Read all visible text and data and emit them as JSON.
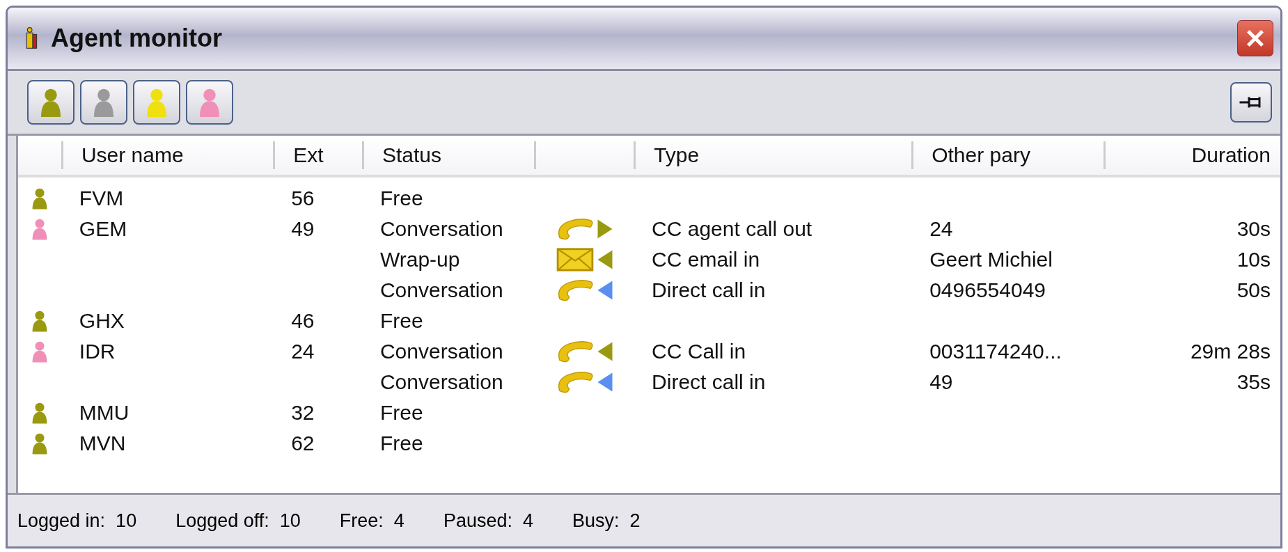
{
  "window": {
    "title": "Agent monitor"
  },
  "toolbar": {
    "filters": [
      {
        "color": "#9a9a10"
      },
      {
        "color": "#9a9a9a"
      },
      {
        "color": "#f0e010"
      },
      {
        "color": "#f090b8"
      }
    ]
  },
  "table": {
    "columns": [
      "User name",
      "Ext",
      "Status",
      "Type",
      "Other pary",
      "Duration"
    ],
    "rows": [
      {
        "agent": {
          "user_name": "FVM",
          "ext": "56",
          "color": "#9a9a10"
        },
        "status": "Free"
      },
      {
        "agent": {
          "user_name": "GEM",
          "ext": "49",
          "color": "#f090b8"
        },
        "status": "Conversation",
        "icons": [
          {
            "kind": "phone"
          },
          {
            "kind": "outgoing",
            "color": "#9a9a10"
          }
        ],
        "type": "CC agent call out",
        "other_party": "24",
        "duration": "30s"
      },
      {
        "status": "Wrap-up",
        "icons": [
          {
            "kind": "email"
          },
          {
            "kind": "incoming",
            "color": "#9a9a10"
          }
        ],
        "type": "CC email in",
        "other_party": "Geert Michiel",
        "duration": "10s"
      },
      {
        "status": "Conversation",
        "icons": [
          {
            "kind": "phone"
          },
          {
            "kind": "incoming",
            "color": "#5a8ef0"
          }
        ],
        "type": "Direct call in",
        "other_party": "0496554049",
        "duration": "50s"
      },
      {
        "agent": {
          "user_name": "GHX",
          "ext": "46",
          "color": "#9a9a10"
        },
        "status": "Free"
      },
      {
        "agent": {
          "user_name": "IDR",
          "ext": "24",
          "color": "#f090b8"
        },
        "status": "Conversation",
        "icons": [
          {
            "kind": "phone"
          },
          {
            "kind": "incoming",
            "color": "#9a9a10"
          }
        ],
        "type": "CC Call in",
        "other_party": "0031174240...",
        "duration": "29m 28s"
      },
      {
        "status": "Conversation",
        "icons": [
          {
            "kind": "phone"
          },
          {
            "kind": "incoming",
            "color": "#5a8ef0"
          }
        ],
        "type": "Direct call in",
        "other_party": "49",
        "duration": "35s"
      },
      {
        "agent": {
          "user_name": "MMU",
          "ext": "32",
          "color": "#9a9a10"
        },
        "status": "Free"
      },
      {
        "agent": {
          "user_name": "MVN",
          "ext": "62",
          "color": "#9a9a10"
        },
        "status": "Free"
      }
    ]
  },
  "status_bar": [
    {
      "label": "Logged in:",
      "value": "10"
    },
    {
      "label": "Logged off:",
      "value": "10"
    },
    {
      "label": "Free:",
      "value": "4"
    },
    {
      "label": "Paused:",
      "value": "4"
    },
    {
      "label": "Busy:",
      "value": "2"
    }
  ]
}
